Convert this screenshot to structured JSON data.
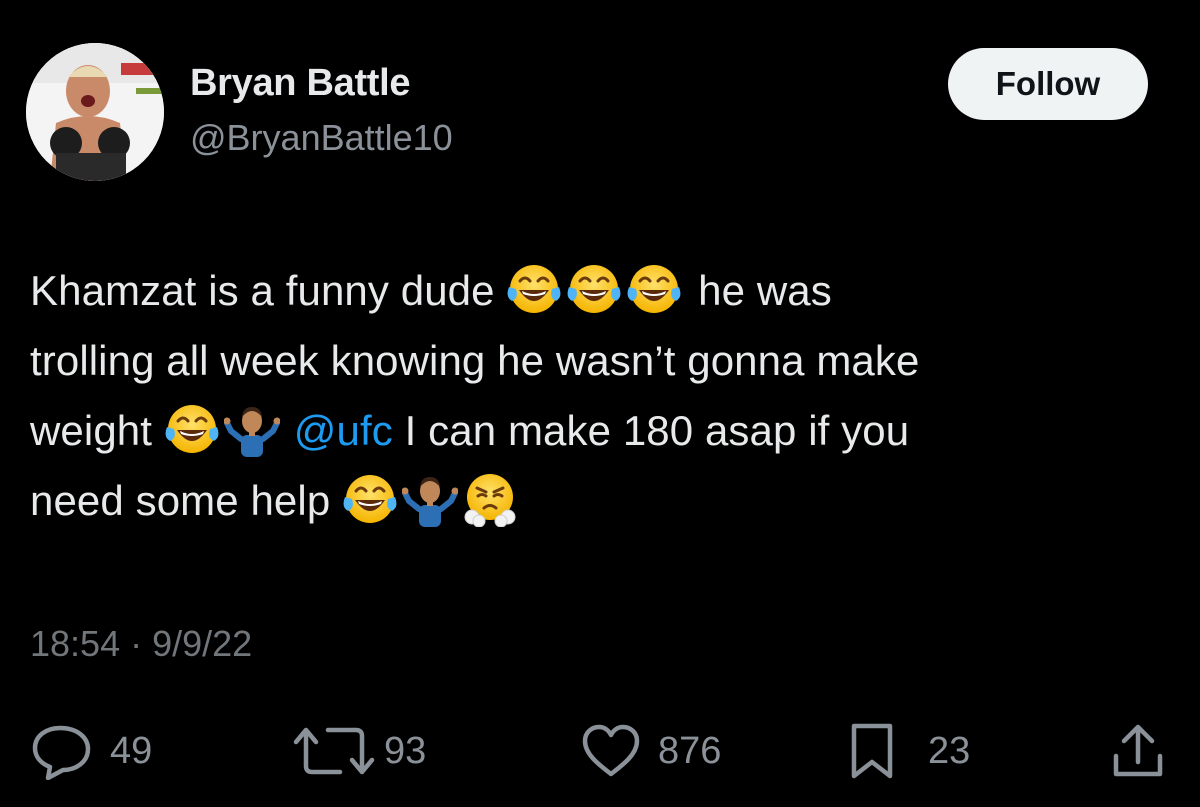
{
  "user": {
    "display_name": "Bryan Battle",
    "handle": "@BryanBattle10"
  },
  "follow_button": {
    "label": "Follow"
  },
  "tweet": {
    "lines": [
      {
        "text_before": "Khamzat is a funny dude ",
        "emojis": [
          "face-with-tears-of-joy",
          "face-with-tears-of-joy",
          "face-with-tears-of-joy"
        ],
        "text_after": " he was"
      },
      {
        "text": "trolling all week knowing he wasn’t gonna make"
      },
      {
        "text_before": "weight ",
        "emojis": [
          "face-with-tears-of-joy",
          "person-shrugging"
        ],
        "mention": "@ufc",
        "text_after": " I can make 180 asap if you"
      },
      {
        "text_before": "need some help ",
        "emojis": [
          "face-with-tears-of-joy",
          "person-shrugging",
          "face-with-steam-from-nose"
        ]
      }
    ],
    "timestamp": "18:54 · 9/9/22"
  },
  "actions": {
    "reply": {
      "icon": "reply-icon",
      "count": "49"
    },
    "retweet": {
      "icon": "retweet-icon",
      "count": "93"
    },
    "like": {
      "icon": "heart-icon",
      "count": "876"
    },
    "bookmark": {
      "icon": "bookmark-icon",
      "count": "23"
    },
    "share": {
      "icon": "share-icon"
    }
  },
  "colors": {
    "background": "#000000",
    "text": "#e7e9ea",
    "secondary_text": "#71767b",
    "link": "#1d9bf0",
    "follow_bg": "#eff3f4"
  }
}
